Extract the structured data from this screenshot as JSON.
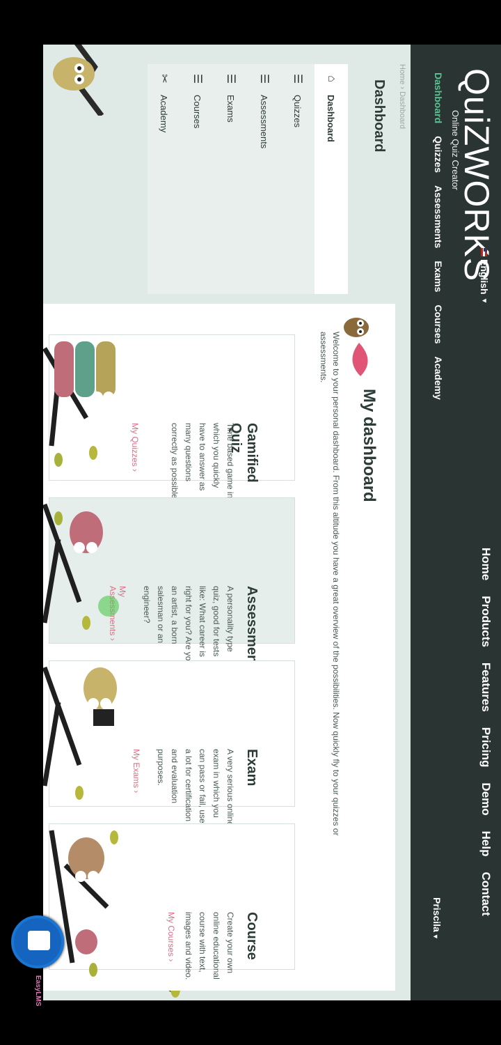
{
  "brand": {
    "logo": "QuiZWORKS",
    "tagline": "Online Quiz Creator"
  },
  "language": {
    "label": "English",
    "dropdown_caret": "▼"
  },
  "top_nav": [
    "Home",
    "Products",
    "Features",
    "Pricing",
    "Demo",
    "Help",
    "Contact"
  ],
  "sub_nav": [
    {
      "label": "Dashboard",
      "active": true
    },
    {
      "label": "Quizzes",
      "active": false
    },
    {
      "label": "Assessments",
      "active": false
    },
    {
      "label": "Exams",
      "active": false
    },
    {
      "label": "Courses",
      "active": false
    },
    {
      "label": "Academy",
      "active": false
    }
  ],
  "user": {
    "name": "Priscila",
    "caret": "▾"
  },
  "breadcrumb": "Home › Dashboard",
  "sidebar": {
    "title": "Dashboard",
    "items": [
      {
        "label": "Dashboard",
        "icon": "home-icon",
        "glyph": "⌂",
        "active": true
      },
      {
        "label": "Quizzes",
        "icon": "list-icon",
        "glyph": "☰",
        "active": false
      },
      {
        "label": "Assessments",
        "icon": "list-icon",
        "glyph": "☰",
        "active": false
      },
      {
        "label": "Exams",
        "icon": "list-icon",
        "glyph": "☰",
        "active": false
      },
      {
        "label": "Courses",
        "icon": "list-icon",
        "glyph": "☰",
        "active": false
      },
      {
        "label": "Academy",
        "icon": "tools-icon",
        "glyph": "✂",
        "active": false
      }
    ]
  },
  "main": {
    "title": "My dashboard",
    "intro": "Welcome to your personal dashboard. From this altitude you have a great overview of the possibilities. Now quickly fly to your quizzes or assessments.",
    "cards": [
      {
        "title": "Gamified Quiz",
        "desc": "Time based game in which you quickly have to answer as many questions correctly as possible.",
        "link": "My Quizzes ›"
      },
      {
        "title": "Assessment",
        "desc": "A personality type quiz, good for tests like: What career is right for you? Are you an artist, a born salesman or an engineer?",
        "link": "My Assessments ›"
      },
      {
        "title": "Exam",
        "desc": "A very serious online exam in which you can pass or fail, used a lot for certification and evaluation purposes.",
        "link": "My Exams ›"
      },
      {
        "title": "Course",
        "desc": "Create your own online educational course with text, images and video.",
        "link": "My Courses ›"
      }
    ]
  },
  "overlay_app": {
    "label": "EasyLMS"
  },
  "colors": {
    "nav_bg": "#2a3533",
    "accent": "#58c291",
    "link": "#d97087",
    "page_bg": "#dfe9e5"
  }
}
